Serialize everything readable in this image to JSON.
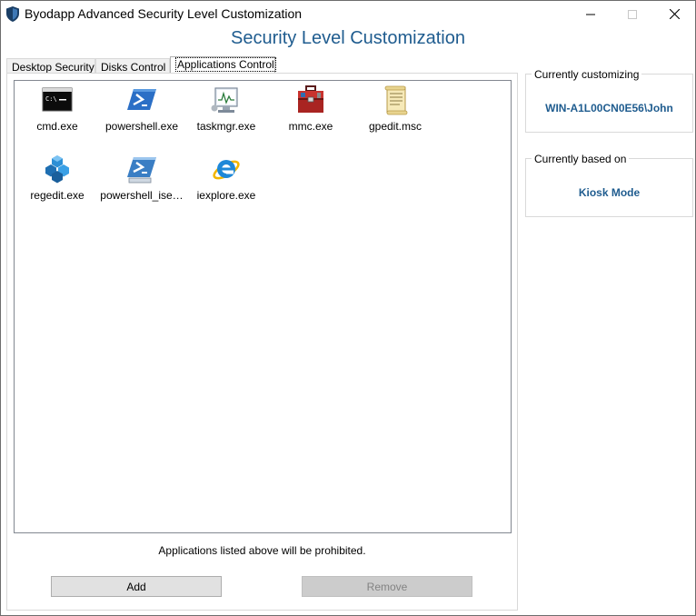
{
  "window": {
    "title": "Byodapp Advanced Security Level Customization",
    "minimize_glyph": "—",
    "maximize_glyph": "☐",
    "close_glyph": "✕"
  },
  "header": {
    "title": "Security Level Customization"
  },
  "tabs": [
    {
      "label": "Desktop Security"
    },
    {
      "label": "Disks Control"
    },
    {
      "label": "Applications Control"
    }
  ],
  "applications": [
    {
      "label": "cmd.exe",
      "icon": "cmd-icon"
    },
    {
      "label": "powershell.exe",
      "icon": "powershell-icon"
    },
    {
      "label": "taskmgr.exe",
      "icon": "task-manager-icon"
    },
    {
      "label": "mmc.exe",
      "icon": "mmc-toolbox-icon"
    },
    {
      "label": "gpedit.msc",
      "icon": "gpedit-scroll-icon"
    },
    {
      "label": "regedit.exe",
      "icon": "regedit-icon"
    },
    {
      "label": "powershell_ise…",
      "icon": "powershell-ise-icon"
    },
    {
      "label": "iexplore.exe",
      "icon": "internet-explorer-icon"
    }
  ],
  "hint": "Applications listed above will be prohibited.",
  "buttons": {
    "add": "Add",
    "remove": "Remove"
  },
  "customizing": {
    "legend": "Currently customizing",
    "value": "WIN-A1L00CN0E56\\John"
  },
  "based_on": {
    "legend": "Currently based on",
    "value": "Kiosk Mode"
  },
  "colors": {
    "accent": "#1f5c8f",
    "button_bg": "#e1e1e1",
    "disabled_button_bg": "#cccccc"
  }
}
